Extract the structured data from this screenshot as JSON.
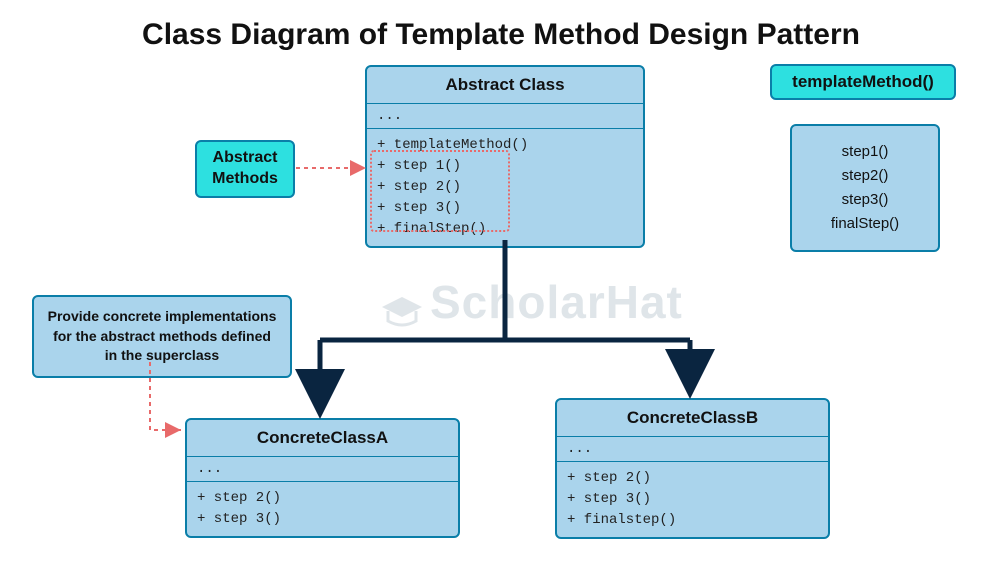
{
  "title": "Class Diagram of Template Method Design Pattern",
  "abstract_class": {
    "name": "Abstract Class",
    "attrs": "...",
    "methods": [
      "+ templateMethod()",
      "+ step 1()",
      "+ step 2()",
      "+ step 3()",
      "+ finalStep()"
    ]
  },
  "concrete_a": {
    "name": "ConcreteClassA",
    "attrs": "...",
    "methods": [
      "+ step 2()",
      "+ step 3()"
    ]
  },
  "concrete_b": {
    "name": "ConcreteClassB",
    "attrs": "...",
    "methods": [
      "+ step 2()",
      "+ step 3()",
      "+ finalstep()"
    ]
  },
  "abstract_methods_label": "Abstract\nMethods",
  "template_method_label": "templateMethod()",
  "steps_box": [
    "step1()",
    "step2()",
    "step3()",
    "finalStep()"
  ],
  "note": "Provide concrete implementations for the abstract methods defined in the superclass",
  "watermark": "ScholarHat"
}
